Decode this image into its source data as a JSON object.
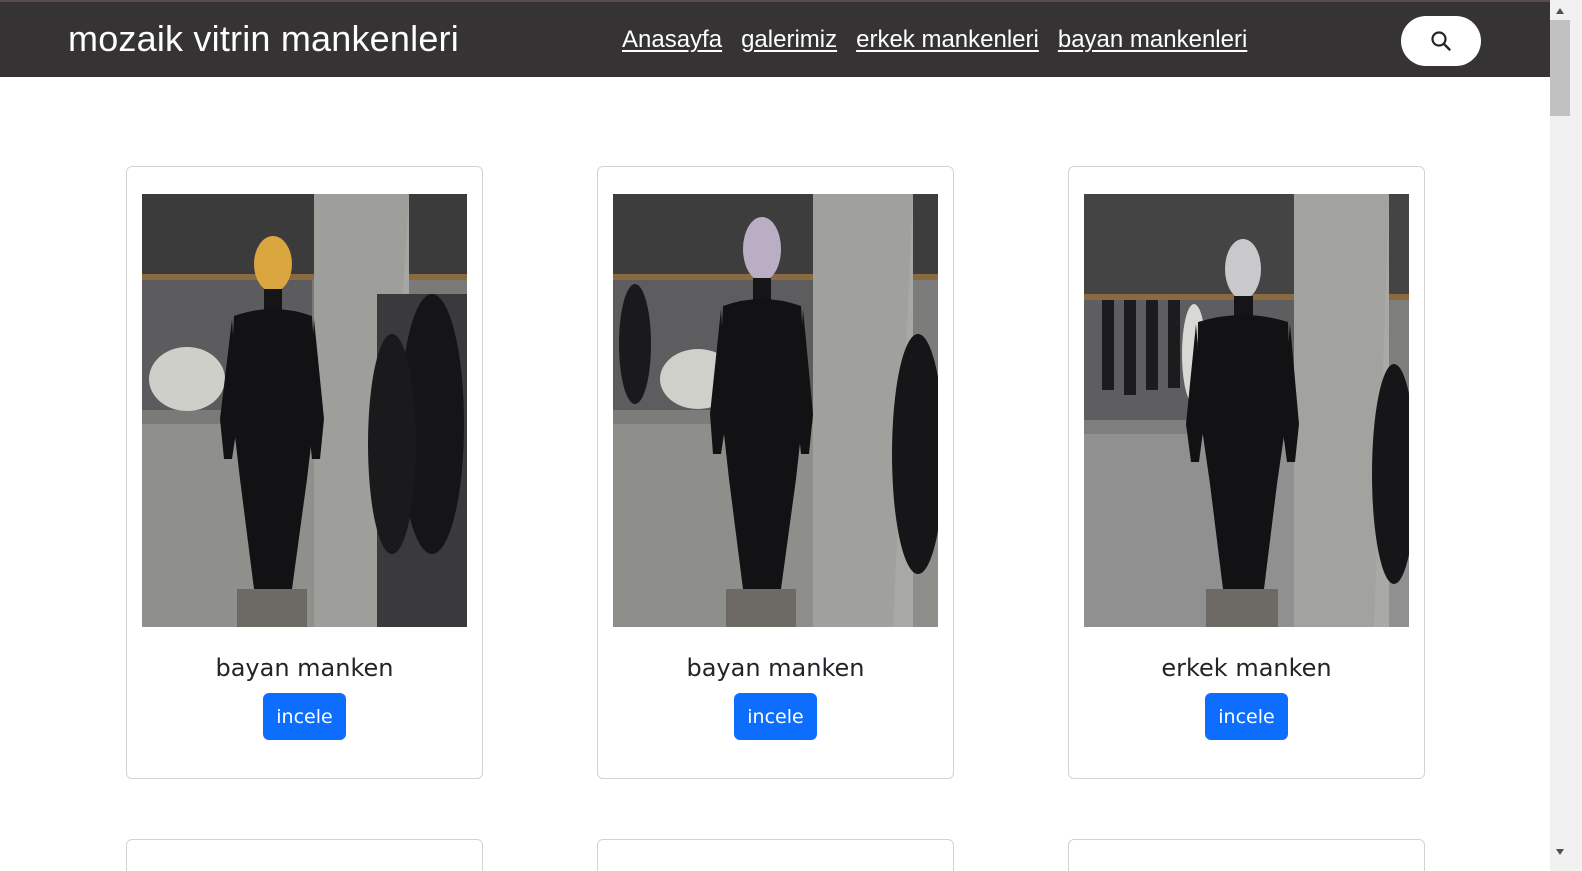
{
  "header": {
    "brand": "mozaik vitrin mankenleri",
    "nav": [
      {
        "label": "Anasayfa"
      },
      {
        "label": "galerimiz"
      },
      {
        "label": "erkek mankenleri"
      },
      {
        "label": "bayan mankenleri"
      }
    ],
    "search_icon": "search-icon"
  },
  "products": [
    {
      "title": "bayan manken",
      "button": "incele",
      "image": "black female mannequin with gold mesh head",
      "head_color": "#d9a640"
    },
    {
      "title": "bayan manken",
      "button": "incele",
      "image": "black female mannequin with silver-lilac mesh head",
      "head_color": "#b9aec4"
    },
    {
      "title": "erkek manken",
      "button": "incele",
      "image": "black male mannequin with silver mesh head",
      "head_color": "#c9c9cc"
    }
  ],
  "colors": {
    "navbar": "#353333",
    "primary": "#0d6efd",
    "card_border": "#d3d3d3"
  }
}
